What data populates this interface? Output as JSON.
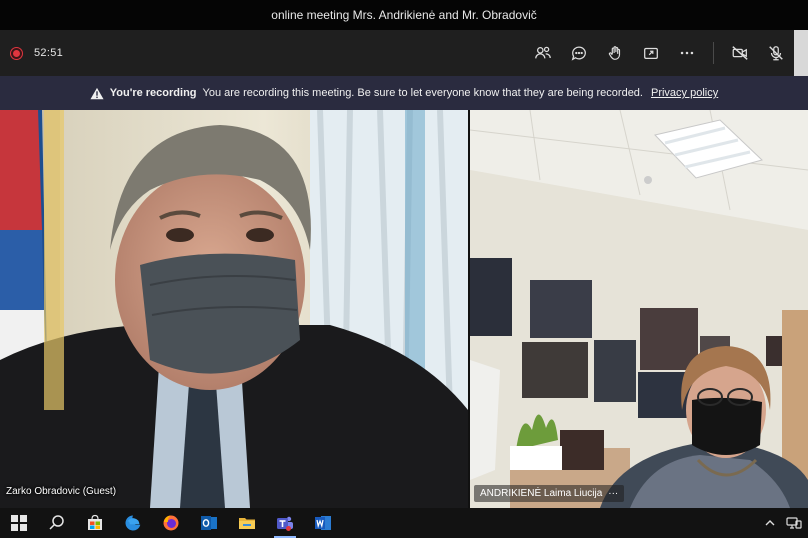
{
  "window": {
    "title": "online meeting Mrs. Andrikienė and Mr. Obradovič"
  },
  "toolbar": {
    "recording_indicator": "recording-dot",
    "timer": "52:51",
    "icons": [
      "participants-icon",
      "chat-icon",
      "raise-hand-icon",
      "share-tray-icon",
      "more-actions-icon",
      "camera-off-icon",
      "mic-off-icon"
    ]
  },
  "banner": {
    "title": "You're recording",
    "message": "You are recording this meeting. Be sure to let everyone know that they are being recorded.",
    "link": "Privacy policy"
  },
  "participants": [
    {
      "name": "Zarko Obradovic (Guest)"
    },
    {
      "name": "ANDRIKIENĖ Laima Liucija",
      "more": "···"
    }
  ],
  "taskbar": {
    "apps": [
      "windows-start-icon",
      "search-icon",
      "store-icon",
      "edge-icon",
      "firefox-icon",
      "outlook-icon",
      "file-explorer-icon",
      "teams-icon",
      "word-icon"
    ],
    "tray": [
      "chevron-up-icon",
      "network-icon"
    ]
  },
  "colors": {
    "recording": "#e0363f",
    "banner_bg": "#2a2b3f",
    "toolbar_bg": "#1f1f1f",
    "taskbar_bg": "#121212"
  }
}
